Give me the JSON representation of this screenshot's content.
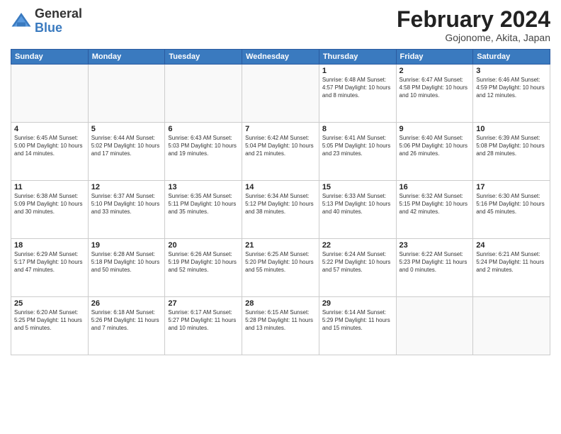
{
  "header": {
    "logo_general": "General",
    "logo_blue": "Blue",
    "title": "February 2024",
    "subtitle": "Gojonome, Akita, Japan"
  },
  "days_of_week": [
    "Sunday",
    "Monday",
    "Tuesday",
    "Wednesday",
    "Thursday",
    "Friday",
    "Saturday"
  ],
  "weeks": [
    [
      {
        "num": "",
        "info": ""
      },
      {
        "num": "",
        "info": ""
      },
      {
        "num": "",
        "info": ""
      },
      {
        "num": "",
        "info": ""
      },
      {
        "num": "1",
        "info": "Sunrise: 6:48 AM\nSunset: 4:57 PM\nDaylight: 10 hours\nand 8 minutes."
      },
      {
        "num": "2",
        "info": "Sunrise: 6:47 AM\nSunset: 4:58 PM\nDaylight: 10 hours\nand 10 minutes."
      },
      {
        "num": "3",
        "info": "Sunrise: 6:46 AM\nSunset: 4:59 PM\nDaylight: 10 hours\nand 12 minutes."
      }
    ],
    [
      {
        "num": "4",
        "info": "Sunrise: 6:45 AM\nSunset: 5:00 PM\nDaylight: 10 hours\nand 14 minutes."
      },
      {
        "num": "5",
        "info": "Sunrise: 6:44 AM\nSunset: 5:02 PM\nDaylight: 10 hours\nand 17 minutes."
      },
      {
        "num": "6",
        "info": "Sunrise: 6:43 AM\nSunset: 5:03 PM\nDaylight: 10 hours\nand 19 minutes."
      },
      {
        "num": "7",
        "info": "Sunrise: 6:42 AM\nSunset: 5:04 PM\nDaylight: 10 hours\nand 21 minutes."
      },
      {
        "num": "8",
        "info": "Sunrise: 6:41 AM\nSunset: 5:05 PM\nDaylight: 10 hours\nand 23 minutes."
      },
      {
        "num": "9",
        "info": "Sunrise: 6:40 AM\nSunset: 5:06 PM\nDaylight: 10 hours\nand 26 minutes."
      },
      {
        "num": "10",
        "info": "Sunrise: 6:39 AM\nSunset: 5:08 PM\nDaylight: 10 hours\nand 28 minutes."
      }
    ],
    [
      {
        "num": "11",
        "info": "Sunrise: 6:38 AM\nSunset: 5:09 PM\nDaylight: 10 hours\nand 30 minutes."
      },
      {
        "num": "12",
        "info": "Sunrise: 6:37 AM\nSunset: 5:10 PM\nDaylight: 10 hours\nand 33 minutes."
      },
      {
        "num": "13",
        "info": "Sunrise: 6:35 AM\nSunset: 5:11 PM\nDaylight: 10 hours\nand 35 minutes."
      },
      {
        "num": "14",
        "info": "Sunrise: 6:34 AM\nSunset: 5:12 PM\nDaylight: 10 hours\nand 38 minutes."
      },
      {
        "num": "15",
        "info": "Sunrise: 6:33 AM\nSunset: 5:13 PM\nDaylight: 10 hours\nand 40 minutes."
      },
      {
        "num": "16",
        "info": "Sunrise: 6:32 AM\nSunset: 5:15 PM\nDaylight: 10 hours\nand 42 minutes."
      },
      {
        "num": "17",
        "info": "Sunrise: 6:30 AM\nSunset: 5:16 PM\nDaylight: 10 hours\nand 45 minutes."
      }
    ],
    [
      {
        "num": "18",
        "info": "Sunrise: 6:29 AM\nSunset: 5:17 PM\nDaylight: 10 hours\nand 47 minutes."
      },
      {
        "num": "19",
        "info": "Sunrise: 6:28 AM\nSunset: 5:18 PM\nDaylight: 10 hours\nand 50 minutes."
      },
      {
        "num": "20",
        "info": "Sunrise: 6:26 AM\nSunset: 5:19 PM\nDaylight: 10 hours\nand 52 minutes."
      },
      {
        "num": "21",
        "info": "Sunrise: 6:25 AM\nSunset: 5:20 PM\nDaylight: 10 hours\nand 55 minutes."
      },
      {
        "num": "22",
        "info": "Sunrise: 6:24 AM\nSunset: 5:22 PM\nDaylight: 10 hours\nand 57 minutes."
      },
      {
        "num": "23",
        "info": "Sunrise: 6:22 AM\nSunset: 5:23 PM\nDaylight: 11 hours\nand 0 minutes."
      },
      {
        "num": "24",
        "info": "Sunrise: 6:21 AM\nSunset: 5:24 PM\nDaylight: 11 hours\nand 2 minutes."
      }
    ],
    [
      {
        "num": "25",
        "info": "Sunrise: 6:20 AM\nSunset: 5:25 PM\nDaylight: 11 hours\nand 5 minutes."
      },
      {
        "num": "26",
        "info": "Sunrise: 6:18 AM\nSunset: 5:26 PM\nDaylight: 11 hours\nand 7 minutes."
      },
      {
        "num": "27",
        "info": "Sunrise: 6:17 AM\nSunset: 5:27 PM\nDaylight: 11 hours\nand 10 minutes."
      },
      {
        "num": "28",
        "info": "Sunrise: 6:15 AM\nSunset: 5:28 PM\nDaylight: 11 hours\nand 13 minutes."
      },
      {
        "num": "29",
        "info": "Sunrise: 6:14 AM\nSunset: 5:29 PM\nDaylight: 11 hours\nand 15 minutes."
      },
      {
        "num": "",
        "info": ""
      },
      {
        "num": "",
        "info": ""
      }
    ]
  ]
}
